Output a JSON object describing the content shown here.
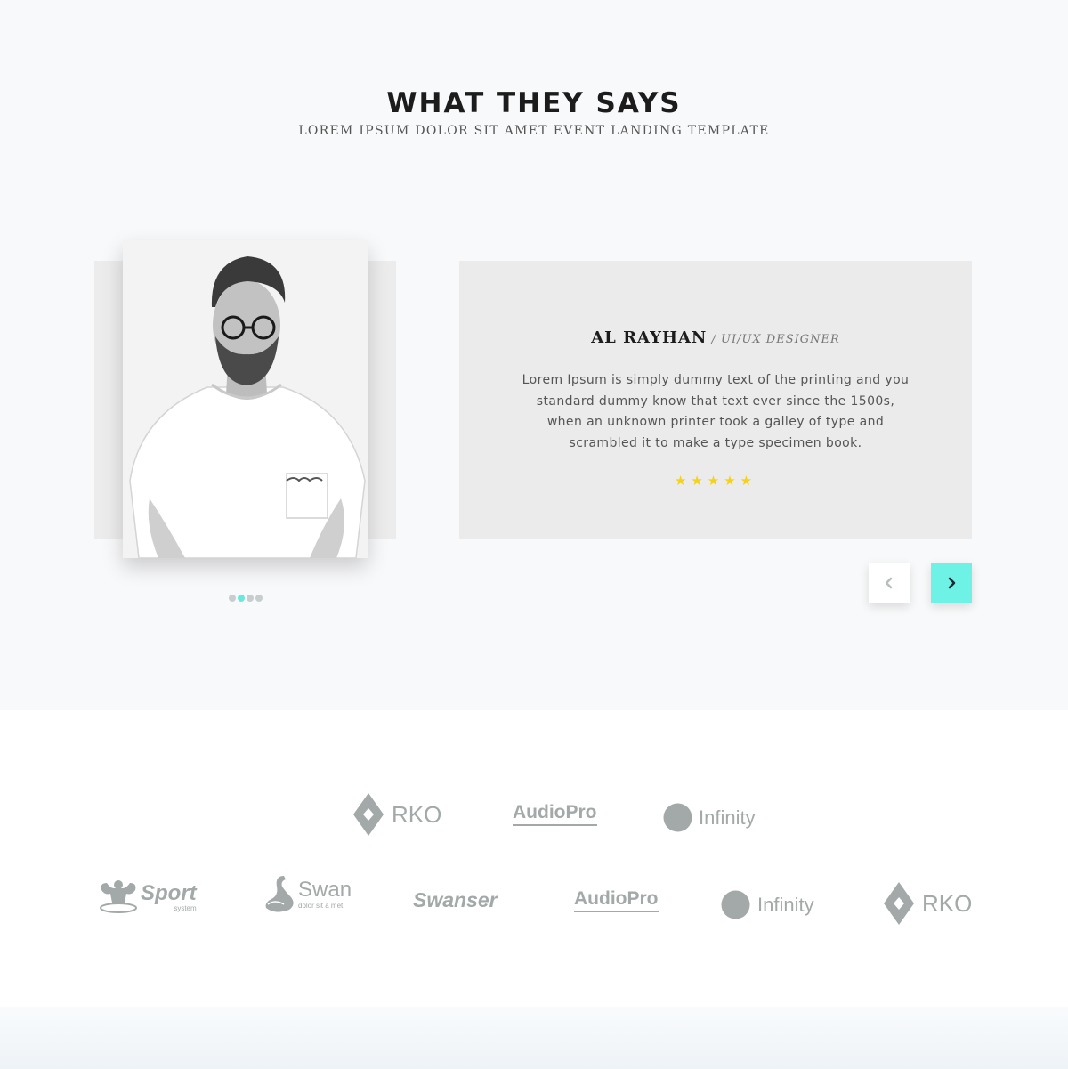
{
  "header": {
    "title": "WHAT THEY SAYS",
    "subtitle": "LOREM IPSUM DOLOR SIT AMET EVENT LANDING TEMPLATE"
  },
  "testimonial": {
    "author_name": "AL RAYHAN",
    "author_role": "/ UI/UX DESIGNER",
    "quote": "Lorem Ipsum is simply dummy text of the printing and you standard dummy know that text ever since the 1500s, when an unknown printer took a galley of type and scrambled it to make a type specimen book.",
    "rating": 5,
    "stars": "★★★★★",
    "star_color": "#f5d21a"
  },
  "slider": {
    "total_dots": 4,
    "active_index": 1,
    "prev_icon": "chevron-left-icon",
    "next_icon": "chevron-right-icon",
    "accent_color": "#6ff2e6"
  },
  "logos": {
    "row1": [
      {
        "name": "RKO",
        "icon": "diamond-icon"
      },
      {
        "name": "AudioPro",
        "icon": ""
      },
      {
        "name": "Infinity",
        "icon": "circle-icon"
      }
    ],
    "row2": [
      {
        "name": "Sport",
        "tagline": "system",
        "icon": "muscle-icon"
      },
      {
        "name": "Swan",
        "tagline": "dolor sit a met",
        "icon": "swan-icon"
      },
      {
        "name": "Swanser",
        "icon": ""
      },
      {
        "name": "AudioPro",
        "icon": ""
      },
      {
        "name": "Infinity",
        "icon": "circle-icon"
      },
      {
        "name": "RKO",
        "icon": "diamond-icon"
      }
    ]
  }
}
